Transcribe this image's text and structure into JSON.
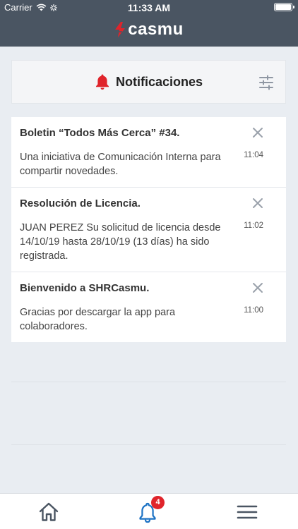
{
  "status_bar": {
    "carrier": "Carrier",
    "time": "11:33 AM"
  },
  "header": {
    "logo_text": "casmu",
    "brand_color": "#e0242b"
  },
  "page": {
    "title": "Notificaciones",
    "title_icon": "bell-icon",
    "filter_icon": "sliders-icon"
  },
  "notifications": [
    {
      "title": "Boletin “Todos Más Cerca” #34.",
      "body": "Una iniciativa de Comunicación Interna para compartir novedades.",
      "time": "11:04"
    },
    {
      "title": "Resolución de Licencia.",
      "body": "JUAN PEREZ Su solicitud de licencia desde 14/10/19 hasta 28/10/19 (13 días) ha sido registrada.",
      "time": "11:02"
    },
    {
      "title": "Bienvenido a SHRCasmu.",
      "body": "Gracias por descargar la app para colaboradores.",
      "time": "11:00"
    }
  ],
  "tabbar": {
    "tabs": [
      {
        "icon": "home-icon"
      },
      {
        "icon": "bell-icon",
        "active": true
      },
      {
        "icon": "menu-icon"
      }
    ],
    "badge_count": "4",
    "active_color": "#1c72c4"
  }
}
